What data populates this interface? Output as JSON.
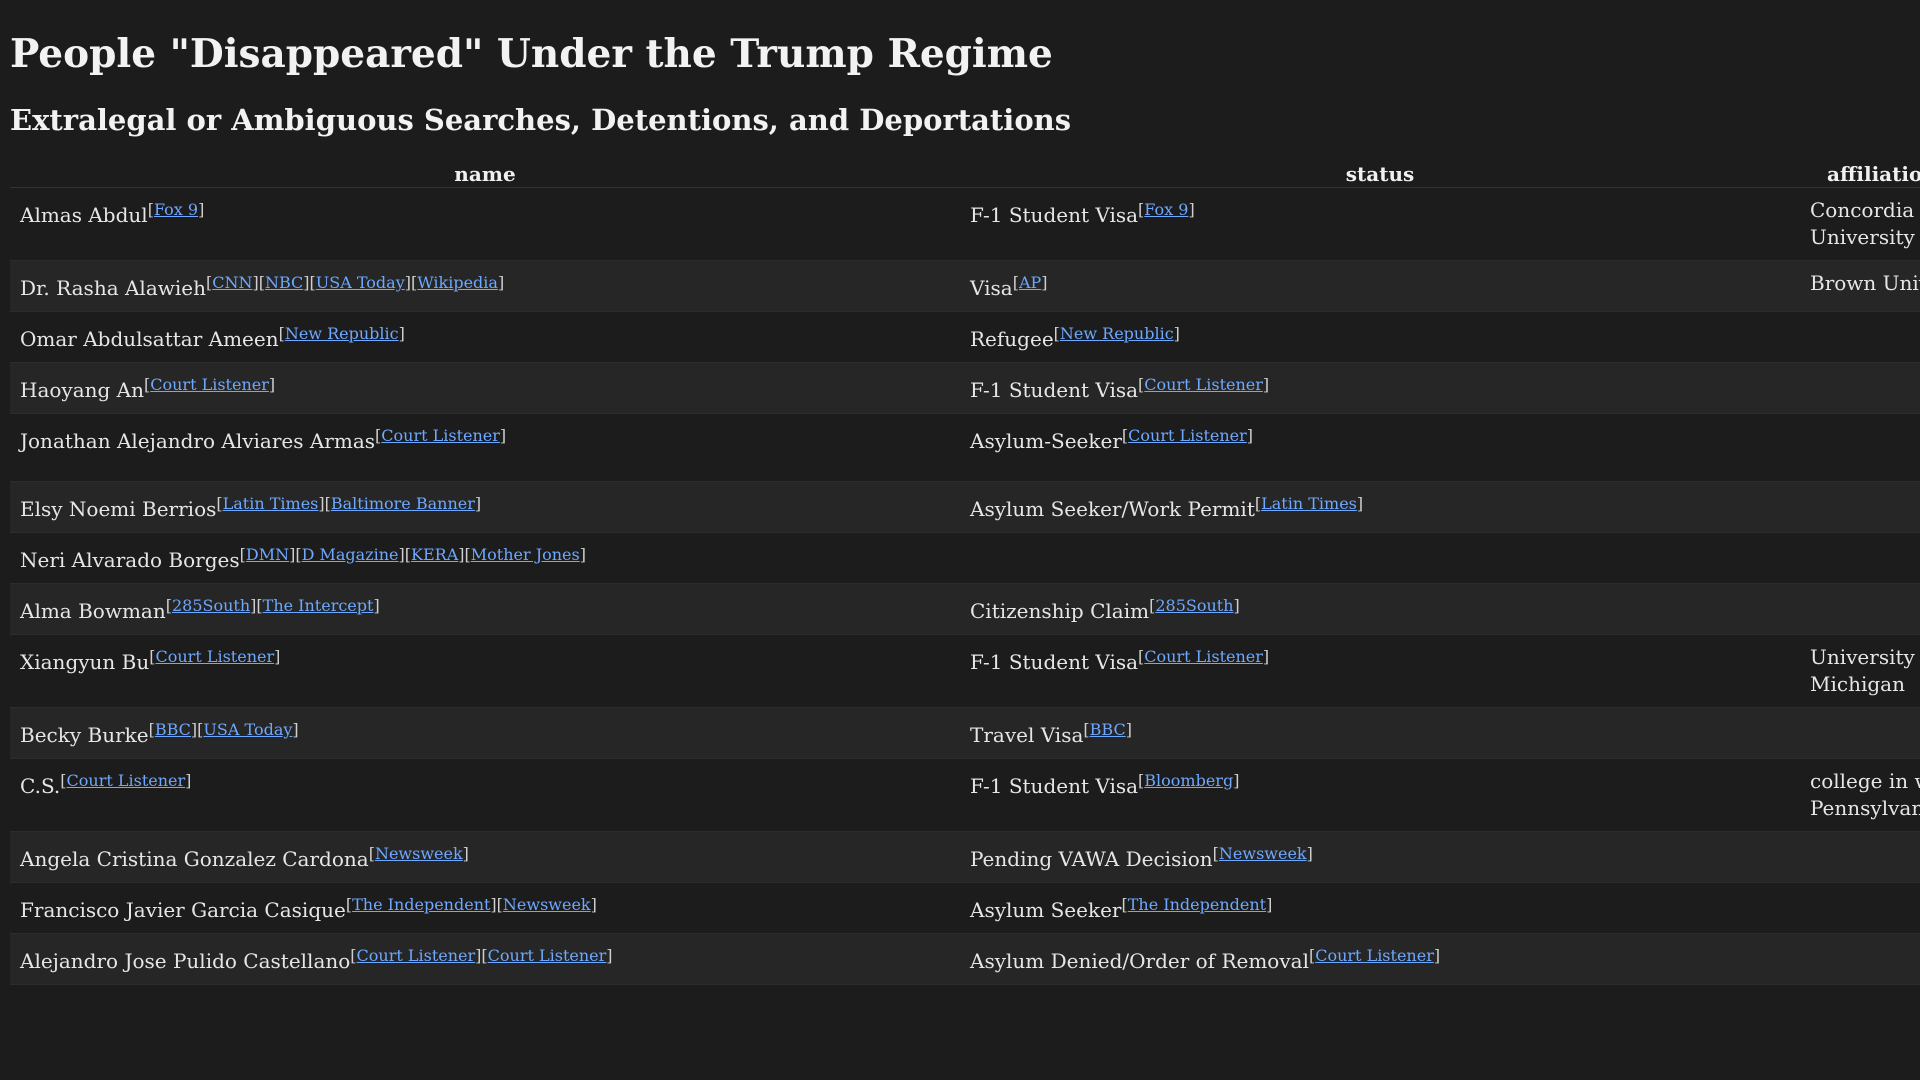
{
  "title": "People \"Disappeared\" Under the Trump Regime",
  "subtitle": "Extralegal or Ambiguous Searches, Detentions, and Deportations",
  "columns": {
    "name": "name",
    "status": "status",
    "affiliation": "affiliation"
  },
  "rows": [
    {
      "name": "Almas Abdul",
      "name_sources": [
        "Fox 9"
      ],
      "status": "F-1 Student Visa",
      "status_sources": [
        "Fox 9"
      ],
      "affiliation": "Concordia University"
    },
    {
      "name": "Dr. Rasha Alawieh",
      "name_sources": [
        "CNN",
        "NBC",
        "USA Today",
        "Wikipedia"
      ],
      "status": "Visa",
      "status_sources": [
        "AP"
      ],
      "affiliation": "Brown University"
    },
    {
      "name": "Omar Abdulsattar Ameen",
      "name_sources": [
        "New Republic"
      ],
      "status": "Refugee",
      "status_sources": [
        "New Republic"
      ],
      "affiliation": ""
    },
    {
      "name": "Haoyang An",
      "name_sources": [
        "Court Listener"
      ],
      "status": "F-1 Student Visa",
      "status_sources": [
        "Court Listener"
      ],
      "affiliation": ""
    },
    {
      "name": "Jonathan Alejandro Alviares Armas",
      "name_sources": [
        "Court Listener"
      ],
      "status": "Asylum-Seeker",
      "status_sources": [
        "Court Listener"
      ],
      "affiliation": "",
      "tall": true
    },
    {
      "name": "Elsy Noemi Berrios",
      "name_sources": [
        "Latin Times",
        "Baltimore Banner"
      ],
      "status": "Asylum Seeker/Work Permit",
      "status_sources": [
        "Latin Times"
      ],
      "affiliation": ""
    },
    {
      "name": "Neri Alvarado Borges",
      "name_sources": [
        "DMN",
        "D Magazine",
        "KERA",
        "Mother Jones"
      ],
      "status": "",
      "status_sources": [],
      "affiliation": ""
    },
    {
      "name": "Alma Bowman",
      "name_sources": [
        "285South",
        "The Intercept"
      ],
      "status": "Citizenship Claim",
      "status_sources": [
        "285South"
      ],
      "affiliation": ""
    },
    {
      "name": "Xiangyun Bu",
      "name_sources": [
        "Court Listener"
      ],
      "status": "F-1 Student Visa",
      "status_sources": [
        "Court Listener"
      ],
      "affiliation": "University of Michigan"
    },
    {
      "name": "Becky Burke",
      "name_sources": [
        "BBC",
        "USA Today"
      ],
      "status": "Travel Visa",
      "status_sources": [
        "BBC"
      ],
      "affiliation": ""
    },
    {
      "name": "C.S.",
      "name_sources": [
        "Court Listener"
      ],
      "status": "F-1 Student Visa",
      "status_sources": [
        "Bloomberg"
      ],
      "affiliation": "college in western Pennsylvania"
    },
    {
      "name": "Angela Cristina Gonzalez Cardona",
      "name_sources": [
        "Newsweek"
      ],
      "status": "Pending VAWA Decision",
      "status_sources": [
        "Newsweek"
      ],
      "affiliation": ""
    },
    {
      "name": "Francisco Javier Garcia Casique",
      "name_sources": [
        "The Independent",
        "Newsweek"
      ],
      "status": "Asylum Seeker",
      "status_sources": [
        "The Independent"
      ],
      "affiliation": ""
    },
    {
      "name": "Alejandro Jose Pulido Castellano",
      "name_sources": [
        "Court Listener",
        "Court Listener"
      ],
      "status": "Asylum Denied/Order of Removal",
      "status_sources": [
        "Court Listener"
      ],
      "affiliation": ""
    }
  ]
}
